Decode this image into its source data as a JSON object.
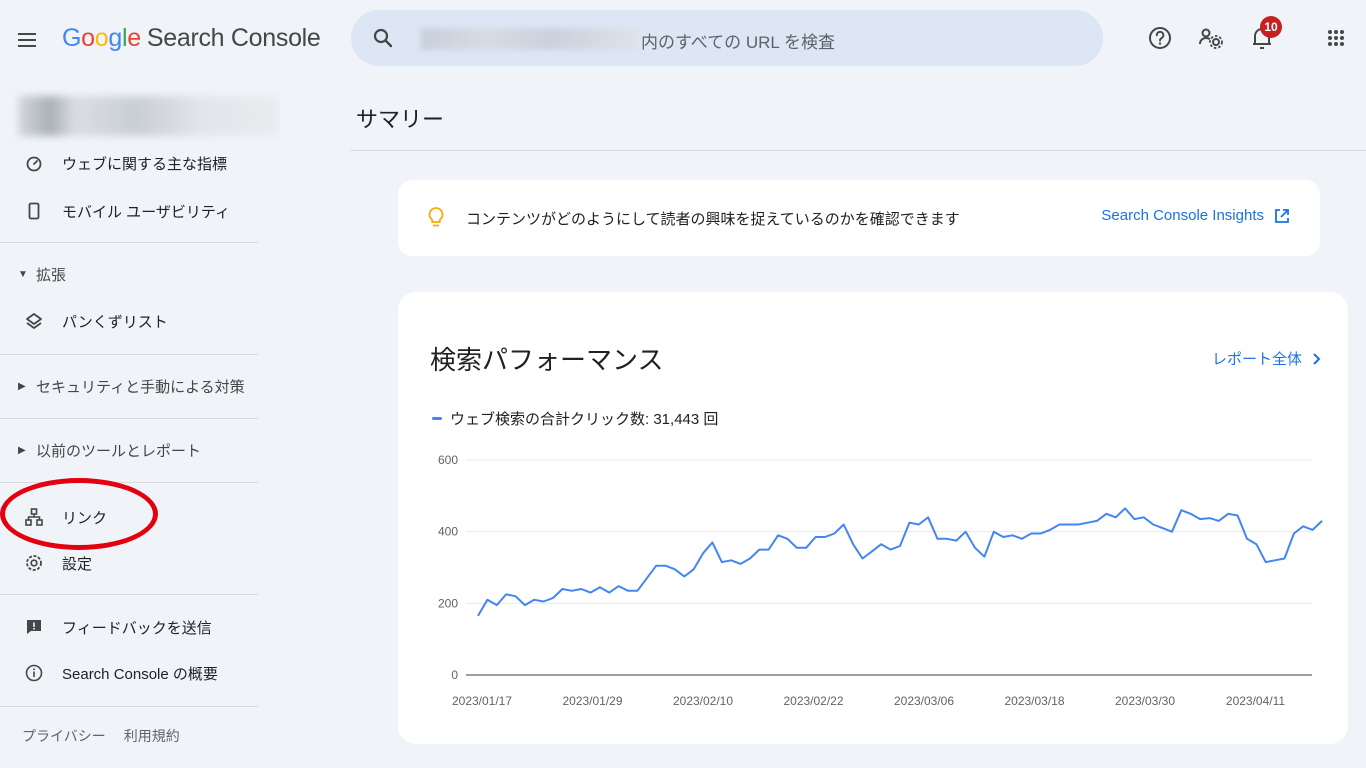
{
  "header": {
    "logo_google": [
      "G",
      "o",
      "o",
      "g",
      "l",
      "e"
    ],
    "logo_product": "Search Console",
    "search_suffix": "内のすべての URL を検査",
    "notifications_count": "10",
    "icons": [
      "menu-icon",
      "search-icon",
      "help-icon",
      "manage-users-icon",
      "notifications-icon",
      "apps-grid-icon"
    ]
  },
  "sidebar": {
    "items_top": [
      {
        "label": "ウェブに関する主な指標",
        "icon": "speedometer-icon"
      },
      {
        "label": "モバイル ユーザビリティ",
        "icon": "smartphone-icon"
      }
    ],
    "section_enhancements": "拡張",
    "breadcrumb_item": "パンくずリスト",
    "section_security": "セキュリティと手動による対策",
    "section_legacy": "以前のツールとレポート",
    "links": "リンク",
    "settings": "設定",
    "feedback": "フィードバックを送信",
    "about": "Search Console の概要",
    "footer": {
      "privacy": "プライバシー",
      "terms": "利用規約"
    }
  },
  "main": {
    "page_title": "サマリー",
    "insight_text": "コンテンツがどのようにして読者の興味を捉えているのかを確認できます",
    "insight_link": "Search Console Insights",
    "perf_title": "検索パフォーマンス",
    "report_link": "レポート全体",
    "legend": "ウェブ検索の合計クリック数: 31,443 回"
  },
  "colors": {
    "accent": "#1a73e8",
    "series": "#4285f4",
    "background": "#f0f4f9",
    "annotation": "#e3000f"
  },
  "chart_data": {
    "type": "line",
    "ylim": [
      0,
      600
    ],
    "yticks": [
      "600",
      "400",
      "200",
      "0"
    ],
    "xtick_labels": [
      "2023/01/17",
      "2023/01/29",
      "2023/02/10",
      "2023/02/22",
      "2023/03/06",
      "2023/03/18",
      "2023/03/30",
      "2023/04/11"
    ],
    "series": [
      {
        "values": [
          165,
          210,
          195,
          225,
          220,
          195,
          210,
          205,
          215,
          240,
          235,
          240,
          230,
          245,
          230,
          248,
          235,
          235,
          270,
          305,
          305,
          295,
          275,
          295,
          340,
          370,
          315,
          320,
          310,
          325,
          350,
          350,
          390,
          380,
          355,
          355,
          385,
          385,
          395,
          420,
          365,
          325,
          345,
          365,
          350,
          360,
          425,
          420,
          440,
          380,
          380,
          375,
          400,
          355,
          330,
          400,
          385,
          390,
          380,
          395,
          395,
          405,
          420,
          420,
          420,
          425,
          430,
          450,
          440,
          465,
          435,
          440,
          420,
          410,
          400,
          460,
          450,
          435,
          438,
          430,
          450,
          445,
          380,
          365,
          315,
          320,
          325,
          395,
          415,
          405,
          430
        ]
      }
    ]
  }
}
